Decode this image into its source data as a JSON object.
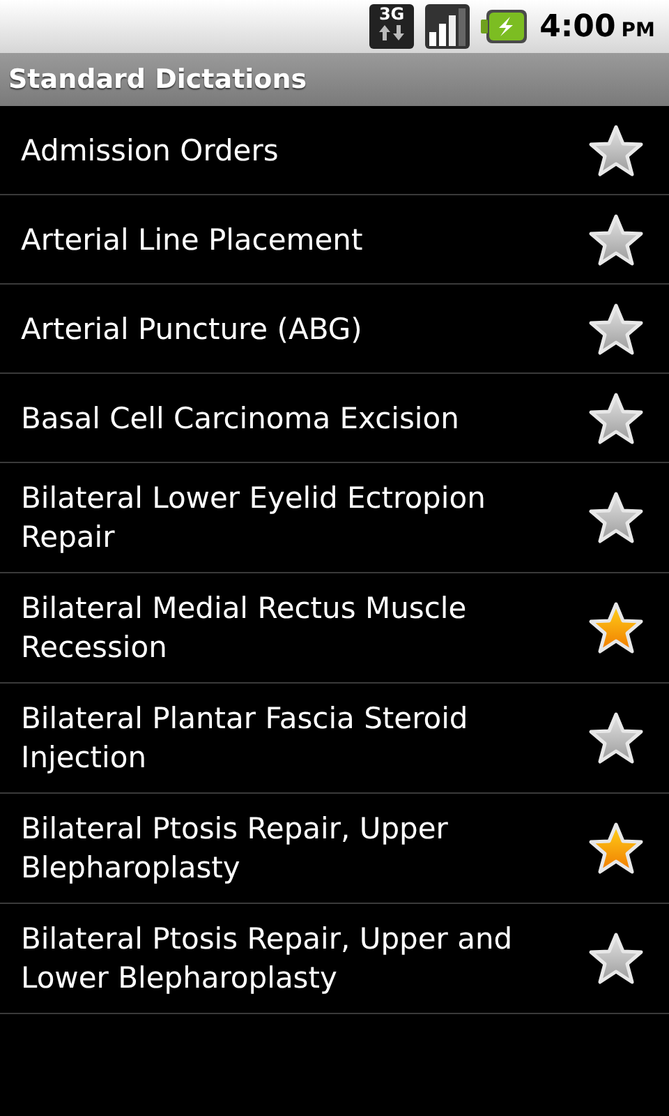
{
  "status_bar": {
    "network": "3G",
    "time": "4:00",
    "period": "PM"
  },
  "title": "Standard Dictations",
  "items": [
    {
      "label": "Admission Orders",
      "starred": false
    },
    {
      "label": "Arterial Line Placement",
      "starred": false
    },
    {
      "label": "Arterial Puncture (ABG)",
      "starred": false
    },
    {
      "label": "Basal Cell Carcinoma Excision",
      "starred": false
    },
    {
      "label": "Bilateral Lower Eyelid Ectropion Repair",
      "starred": false
    },
    {
      "label": "Bilateral Medial Rectus Muscle Recession",
      "starred": true
    },
    {
      "label": "Bilateral Plantar Fascia Steroid Injection",
      "starred": false
    },
    {
      "label": "Bilateral Ptosis Repair, Upper Blepharoplasty",
      "starred": true
    },
    {
      "label": "Bilateral Ptosis Repair, Upper and Lower Blepharoplasty",
      "starred": false
    }
  ]
}
